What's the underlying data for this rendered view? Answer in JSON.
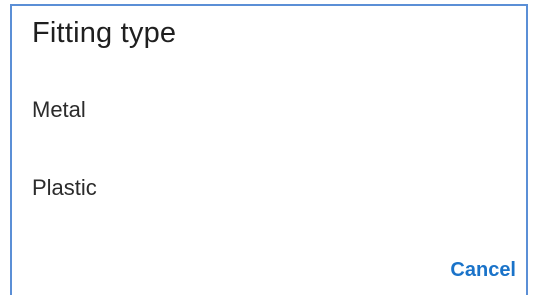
{
  "dialog": {
    "title": "Fitting type",
    "options": [
      {
        "label": "Metal"
      },
      {
        "label": "Plastic"
      }
    ],
    "cancel_label": "Cancel"
  },
  "colors": {
    "border": "#5b8fd6",
    "accent": "#1a73c9",
    "text": "#202124"
  }
}
